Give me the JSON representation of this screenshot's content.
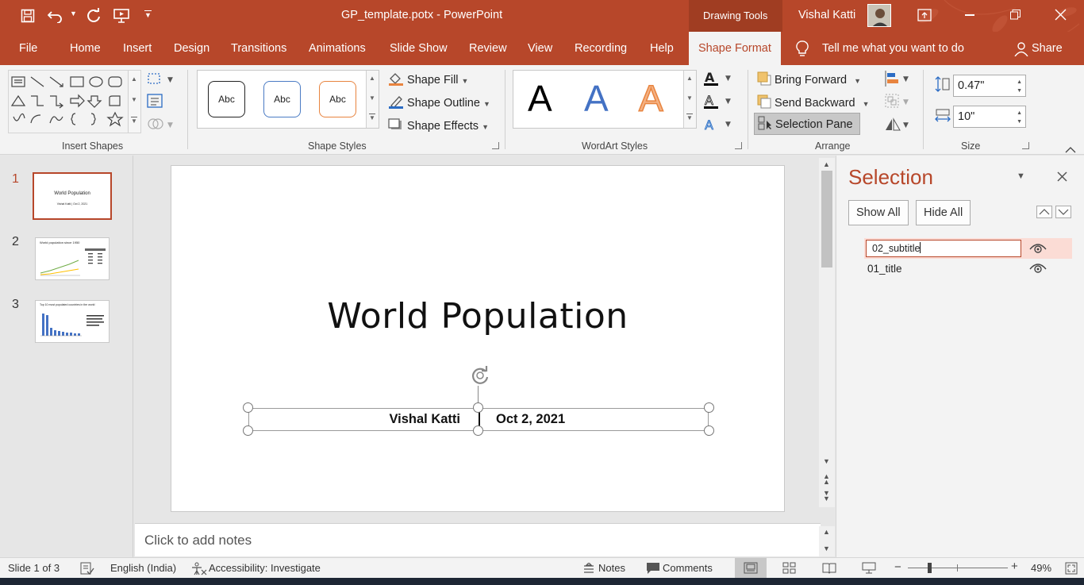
{
  "window": {
    "title": "GP_template.potx  -  PowerPoint",
    "context_tab_group": "Drawing Tools",
    "user_name": "Vishal Katti"
  },
  "quick_access": {
    "icons": [
      "save-icon",
      "undo-icon",
      "redo-icon",
      "present-icon",
      "customize-icon"
    ]
  },
  "tabs": [
    "File",
    "Home",
    "Insert",
    "Design",
    "Transitions",
    "Animations",
    "Slide Show",
    "Review",
    "View",
    "Recording",
    "Help",
    "Shape Format"
  ],
  "active_tab": "Shape Format",
  "tell_me": "Tell me what you want to do",
  "share_label": "Share",
  "ribbon": {
    "insert_shapes": {
      "label": "Insert Shapes"
    },
    "shape_styles": {
      "label": "Shape Styles",
      "gallery": [
        "Abc",
        "Abc",
        "Abc"
      ],
      "fill": "Shape Fill",
      "outline": "Shape Outline",
      "effects": "Shape Effects"
    },
    "wordart": {
      "label": "WordArt Styles",
      "letters": [
        "A",
        "A",
        "A"
      ]
    },
    "arrange": {
      "label": "Arrange",
      "bring_forward": "Bring Forward",
      "send_backward": "Send Backward",
      "selection_pane": "Selection Pane"
    },
    "size": {
      "label": "Size",
      "height": "0.47\"",
      "width": "10\""
    }
  },
  "thumbnails": {
    "numbers": [
      "1",
      "2",
      "3"
    ],
    "slide1": {
      "title": "World Population",
      "subtitle": "Vishal Katti  |  Oct 2, 2021"
    },
    "slide2": {
      "title": "World population since 1950"
    },
    "slide3": {
      "title": "Top 10 most populated countries in the world"
    }
  },
  "slide": {
    "title": "World Population",
    "author": "Vishal Katti",
    "date": "Oct 2, 2021"
  },
  "notes_placeholder": "Click to add notes",
  "selection_pane": {
    "title": "Selection",
    "show_all": "Show All",
    "hide_all": "Hide All",
    "items": [
      "02_subtitle",
      "01_title"
    ],
    "editing_item": "02_subtitle"
  },
  "status": {
    "slide_info": "Slide 1 of 3",
    "language": "English (India)",
    "accessibility": "Accessibility: Investigate",
    "notes": "Notes",
    "comments": "Comments",
    "zoom": "49%",
    "zoom_level": 0.49
  },
  "colors": {
    "accent": "#b7472a",
    "selected_item": "#fbdcd5",
    "statusbar": "#f3f3f3"
  }
}
